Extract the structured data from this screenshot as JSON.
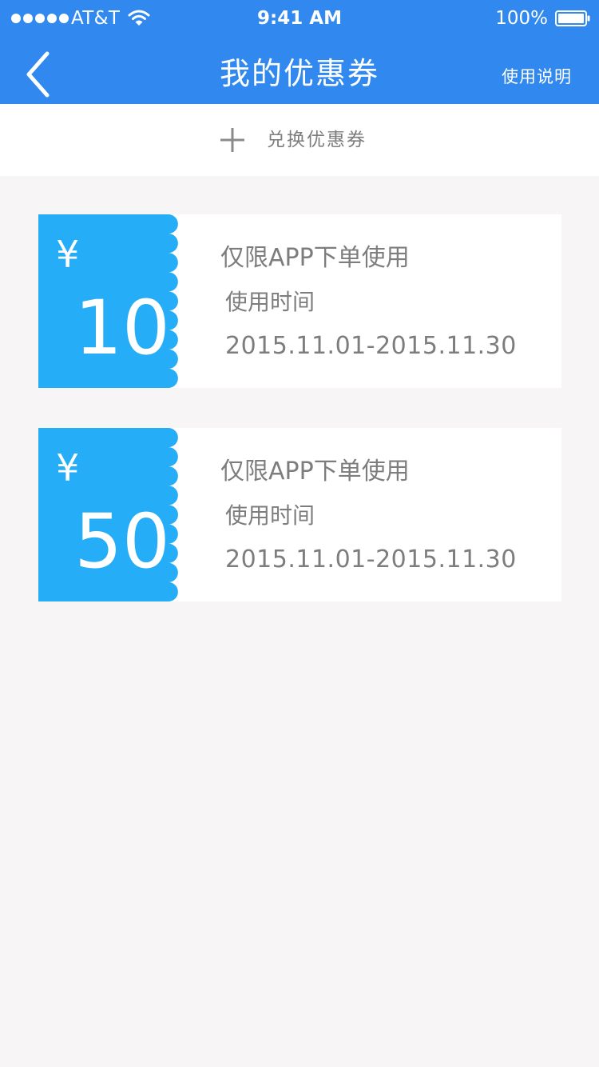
{
  "status_bar": {
    "carrier": "AT&T",
    "time": "9:41 AM",
    "battery_percent": "100%",
    "signal_icon": "signal-dots-icon",
    "wifi_icon": "wifi-icon",
    "battery_icon": "battery-icon"
  },
  "header": {
    "back_icon": "chevron-left-icon",
    "title": "我的优惠券",
    "help_label": "使用说明",
    "background_color": "#3188ee"
  },
  "redeem": {
    "icon": "plus-icon",
    "label": "兑换优惠券"
  },
  "coupons": [
    {
      "currency": "¥",
      "amount": "10",
      "description": "仅限APP下单使用",
      "time_label": "使用时间",
      "time_range": "2015.11.01-2015.11.30"
    },
    {
      "currency": "¥",
      "amount": "50",
      "description": "仅限APP下单使用",
      "time_label": "使用时间",
      "time_range": "2015.11.01-2015.11.30"
    }
  ],
  "colors": {
    "coupon_stub": "#25aef7",
    "page_background": "#f7f5f6",
    "text_gray": "#7d7d7d"
  }
}
